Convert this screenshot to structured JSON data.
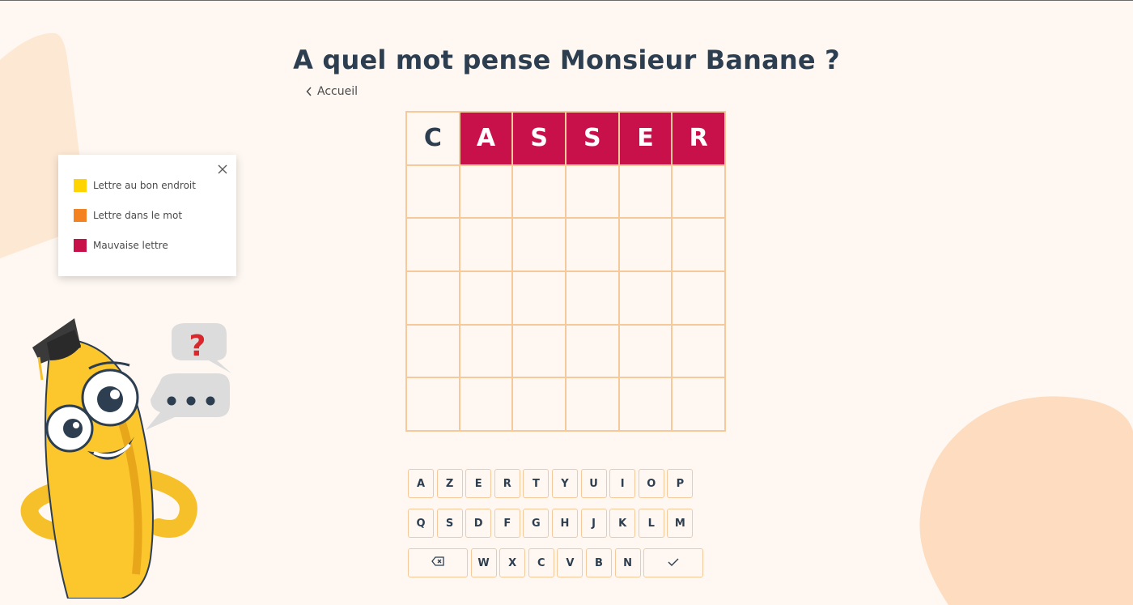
{
  "title": "A quel mot pense Monsieur Banane ?",
  "back": {
    "label": "Accueil",
    "icon": "chevron-left-icon"
  },
  "colors": {
    "correct": "#ffd400",
    "present": "#f58220",
    "wrong": "#c8104b",
    "grid_border": "#f6c99b",
    "background": "#fff8f2"
  },
  "legend": {
    "items": [
      {
        "label": "Lettre au bon endroit",
        "color": "#ffd400"
      },
      {
        "label": "Lettre dans le mot",
        "color": "#f58220"
      },
      {
        "label": "Mauvaise lettre",
        "color": "#c8104b"
      }
    ],
    "close_icon": "close-icon"
  },
  "grid": {
    "rows": [
      [
        {
          "letter": "C",
          "state": "given"
        },
        {
          "letter": "A",
          "state": "wrong"
        },
        {
          "letter": "S",
          "state": "wrong"
        },
        {
          "letter": "S",
          "state": "wrong"
        },
        {
          "letter": "E",
          "state": "wrong"
        },
        {
          "letter": "R",
          "state": "wrong"
        }
      ],
      [
        {
          "letter": "",
          "state": "empty"
        },
        {
          "letter": "",
          "state": "empty"
        },
        {
          "letter": "",
          "state": "empty"
        },
        {
          "letter": "",
          "state": "empty"
        },
        {
          "letter": "",
          "state": "empty"
        },
        {
          "letter": "",
          "state": "empty"
        }
      ],
      [
        {
          "letter": "",
          "state": "empty"
        },
        {
          "letter": "",
          "state": "empty"
        },
        {
          "letter": "",
          "state": "empty"
        },
        {
          "letter": "",
          "state": "empty"
        },
        {
          "letter": "",
          "state": "empty"
        },
        {
          "letter": "",
          "state": "empty"
        }
      ],
      [
        {
          "letter": "",
          "state": "empty"
        },
        {
          "letter": "",
          "state": "empty"
        },
        {
          "letter": "",
          "state": "empty"
        },
        {
          "letter": "",
          "state": "empty"
        },
        {
          "letter": "",
          "state": "empty"
        },
        {
          "letter": "",
          "state": "empty"
        }
      ],
      [
        {
          "letter": "",
          "state": "empty"
        },
        {
          "letter": "",
          "state": "empty"
        },
        {
          "letter": "",
          "state": "empty"
        },
        {
          "letter": "",
          "state": "empty"
        },
        {
          "letter": "",
          "state": "empty"
        },
        {
          "letter": "",
          "state": "empty"
        }
      ],
      [
        {
          "letter": "",
          "state": "empty"
        },
        {
          "letter": "",
          "state": "empty"
        },
        {
          "letter": "",
          "state": "empty"
        },
        {
          "letter": "",
          "state": "empty"
        },
        {
          "letter": "",
          "state": "empty"
        },
        {
          "letter": "",
          "state": "empty"
        }
      ]
    ]
  },
  "keyboard": {
    "rows": [
      [
        "A",
        "Z",
        "E",
        "R",
        "T",
        "Y",
        "U",
        "I",
        "O",
        "P"
      ],
      [
        "Q",
        "S",
        "D",
        "F",
        "G",
        "H",
        "J",
        "K",
        "L",
        "M"
      ],
      [
        "{backspace}",
        "W",
        "X",
        "C",
        "V",
        "B",
        "N",
        "{enter}"
      ]
    ],
    "backspace_icon": "backspace-icon",
    "enter_icon": "check-icon"
  },
  "mascot": {
    "question_mark": "?",
    "ellipsis": "•••"
  }
}
